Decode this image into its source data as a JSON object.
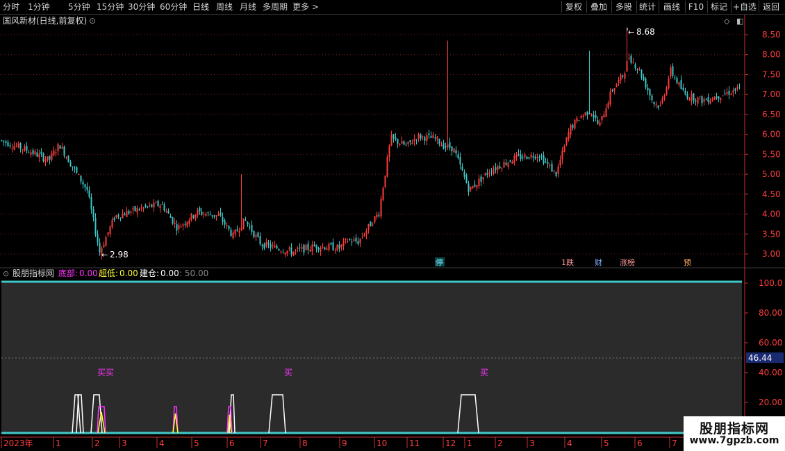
{
  "toolbar": {
    "periods": [
      "分时",
      "1分钟",
      "5分钟",
      "15分钟",
      "30分钟",
      "60分钟",
      "日线",
      "周线",
      "月线",
      "多周期",
      "更多 >"
    ],
    "active_period": "日线",
    "right_buttons": [
      "复权",
      "叠加",
      "多股",
      "统计",
      "画线",
      "F10",
      "标记",
      "+自选",
      "返回"
    ]
  },
  "main_chart": {
    "title": "国风新材(日线,前复权)",
    "yticks": [
      "8.50",
      "8.00",
      "7.50",
      "7.00",
      "6.50",
      "6.00",
      "5.50",
      "5.00",
      "4.50",
      "4.00",
      "3.50",
      "3.00"
    ],
    "high_label": "8.68",
    "low_label": "2.98",
    "markers": [
      "停",
      "1跌",
      "财",
      "涨榜",
      "预"
    ]
  },
  "indicator": {
    "name": "股朋指标网",
    "di_bu_label": "底部:",
    "di_bu_value": "0.00",
    "chao_di_label": "超低:",
    "chao_di_value": "0.00",
    "jian_cang_label": "建仓:",
    "jian_cang_value": "0.00",
    "level_label": ": 50.00",
    "yticks": [
      "100.0",
      "80.00",
      "60.00",
      "40.00",
      "20.00"
    ],
    "current_value": "46.44",
    "buy_labels": [
      "买买",
      "买",
      "买"
    ]
  },
  "time_axis": [
    "2023年",
    "1",
    "2",
    "3",
    "4",
    "5",
    "6",
    "7",
    "8",
    "9",
    "10",
    "11",
    "12",
    "1",
    "2",
    "3",
    "4",
    "5",
    "6",
    "7"
  ],
  "watermark": {
    "line1": "股朋指标网",
    "line2": "www.7gpzb.com"
  },
  "colors": {
    "up": "#ff3c3c",
    "down": "#3cc8c8",
    "grid": "#7a1a1a",
    "axis": "#c83232",
    "magenta": "#ff33ff",
    "yellow": "#ffff33",
    "white": "#ffffff"
  }
}
